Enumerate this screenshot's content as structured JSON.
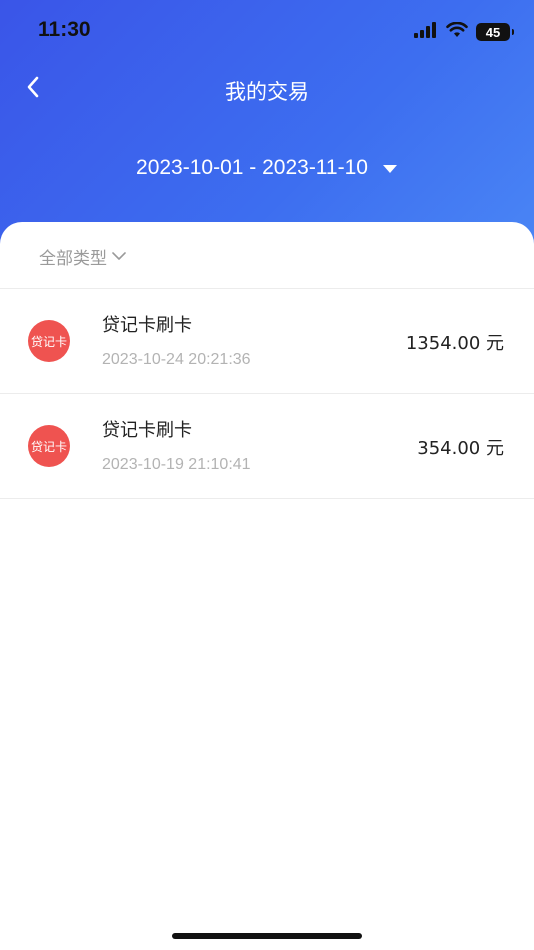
{
  "status_bar": {
    "time": "11:30",
    "battery": "45"
  },
  "nav": {
    "title": "我的交易"
  },
  "date_range": {
    "label": "2023-10-01 - 2023-11-10"
  },
  "filter": {
    "label": "全部类型"
  },
  "transactions": [
    {
      "badge": "贷记卡",
      "title": "贷记卡刷卡",
      "time": "2023-10-24 20:21:36",
      "amount": "1354.00 元"
    },
    {
      "badge": "贷记卡",
      "title": "贷记卡刷卡",
      "time": "2023-10-19 21:10:41",
      "amount": "354.00 元"
    }
  ],
  "colors": {
    "header_start": "#3a55e8",
    "header_end": "#4a86f5",
    "badge": "#ef5350",
    "muted_text": "#9a9a9a"
  },
  "icons": [
    "cellular-signal-icon",
    "wifi-icon",
    "battery-icon",
    "back-chevron-icon",
    "dropdown-triangle-icon",
    "filter-chevron-icon"
  ]
}
